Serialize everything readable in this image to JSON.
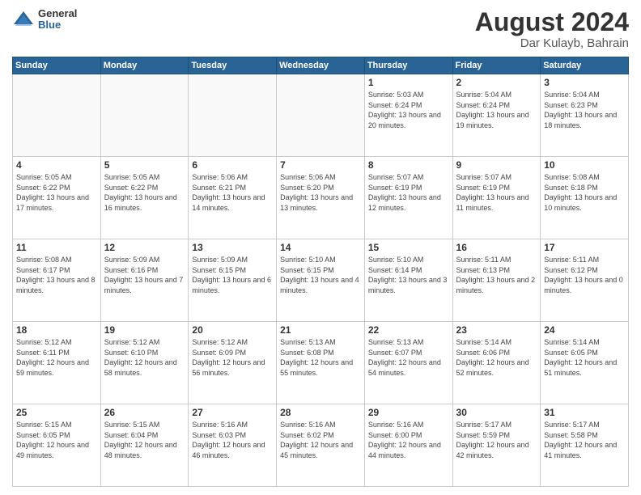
{
  "header": {
    "logo_general": "General",
    "logo_blue": "Blue",
    "month_year": "August 2024",
    "location": "Dar Kulayb, Bahrain"
  },
  "days_of_week": [
    "Sunday",
    "Monday",
    "Tuesday",
    "Wednesday",
    "Thursday",
    "Friday",
    "Saturday"
  ],
  "weeks": [
    [
      {
        "day": "",
        "empty": true
      },
      {
        "day": "",
        "empty": true
      },
      {
        "day": "",
        "empty": true
      },
      {
        "day": "",
        "empty": true
      },
      {
        "day": "1",
        "sunrise": "5:03 AM",
        "sunset": "6:24 PM",
        "daylight": "13 hours and 20 minutes."
      },
      {
        "day": "2",
        "sunrise": "5:04 AM",
        "sunset": "6:24 PM",
        "daylight": "13 hours and 19 minutes."
      },
      {
        "day": "3",
        "sunrise": "5:04 AM",
        "sunset": "6:23 PM",
        "daylight": "13 hours and 18 minutes."
      }
    ],
    [
      {
        "day": "4",
        "sunrise": "5:05 AM",
        "sunset": "6:22 PM",
        "daylight": "13 hours and 17 minutes."
      },
      {
        "day": "5",
        "sunrise": "5:05 AM",
        "sunset": "6:22 PM",
        "daylight": "13 hours and 16 minutes."
      },
      {
        "day": "6",
        "sunrise": "5:06 AM",
        "sunset": "6:21 PM",
        "daylight": "13 hours and 14 minutes."
      },
      {
        "day": "7",
        "sunrise": "5:06 AM",
        "sunset": "6:20 PM",
        "daylight": "13 hours and 13 minutes."
      },
      {
        "day": "8",
        "sunrise": "5:07 AM",
        "sunset": "6:19 PM",
        "daylight": "13 hours and 12 minutes."
      },
      {
        "day": "9",
        "sunrise": "5:07 AM",
        "sunset": "6:19 PM",
        "daylight": "13 hours and 11 minutes."
      },
      {
        "day": "10",
        "sunrise": "5:08 AM",
        "sunset": "6:18 PM",
        "daylight": "13 hours and 10 minutes."
      }
    ],
    [
      {
        "day": "11",
        "sunrise": "5:08 AM",
        "sunset": "6:17 PM",
        "daylight": "13 hours and 8 minutes."
      },
      {
        "day": "12",
        "sunrise": "5:09 AM",
        "sunset": "6:16 PM",
        "daylight": "13 hours and 7 minutes."
      },
      {
        "day": "13",
        "sunrise": "5:09 AM",
        "sunset": "6:15 PM",
        "daylight": "13 hours and 6 minutes."
      },
      {
        "day": "14",
        "sunrise": "5:10 AM",
        "sunset": "6:15 PM",
        "daylight": "13 hours and 4 minutes."
      },
      {
        "day": "15",
        "sunrise": "5:10 AM",
        "sunset": "6:14 PM",
        "daylight": "13 hours and 3 minutes."
      },
      {
        "day": "16",
        "sunrise": "5:11 AM",
        "sunset": "6:13 PM",
        "daylight": "13 hours and 2 minutes."
      },
      {
        "day": "17",
        "sunrise": "5:11 AM",
        "sunset": "6:12 PM",
        "daylight": "13 hours and 0 minutes."
      }
    ],
    [
      {
        "day": "18",
        "sunrise": "5:12 AM",
        "sunset": "6:11 PM",
        "daylight": "12 hours and 59 minutes."
      },
      {
        "day": "19",
        "sunrise": "5:12 AM",
        "sunset": "6:10 PM",
        "daylight": "12 hours and 58 minutes."
      },
      {
        "day": "20",
        "sunrise": "5:12 AM",
        "sunset": "6:09 PM",
        "daylight": "12 hours and 56 minutes."
      },
      {
        "day": "21",
        "sunrise": "5:13 AM",
        "sunset": "6:08 PM",
        "daylight": "12 hours and 55 minutes."
      },
      {
        "day": "22",
        "sunrise": "5:13 AM",
        "sunset": "6:07 PM",
        "daylight": "12 hours and 54 minutes."
      },
      {
        "day": "23",
        "sunrise": "5:14 AM",
        "sunset": "6:06 PM",
        "daylight": "12 hours and 52 minutes."
      },
      {
        "day": "24",
        "sunrise": "5:14 AM",
        "sunset": "6:05 PM",
        "daylight": "12 hours and 51 minutes."
      }
    ],
    [
      {
        "day": "25",
        "sunrise": "5:15 AM",
        "sunset": "6:05 PM",
        "daylight": "12 hours and 49 minutes."
      },
      {
        "day": "26",
        "sunrise": "5:15 AM",
        "sunset": "6:04 PM",
        "daylight": "12 hours and 48 minutes."
      },
      {
        "day": "27",
        "sunrise": "5:16 AM",
        "sunset": "6:03 PM",
        "daylight": "12 hours and 46 minutes."
      },
      {
        "day": "28",
        "sunrise": "5:16 AM",
        "sunset": "6:02 PM",
        "daylight": "12 hours and 45 minutes."
      },
      {
        "day": "29",
        "sunrise": "5:16 AM",
        "sunset": "6:00 PM",
        "daylight": "12 hours and 44 minutes."
      },
      {
        "day": "30",
        "sunrise": "5:17 AM",
        "sunset": "5:59 PM",
        "daylight": "12 hours and 42 minutes."
      },
      {
        "day": "31",
        "sunrise": "5:17 AM",
        "sunset": "5:58 PM",
        "daylight": "12 hours and 41 minutes."
      }
    ]
  ],
  "labels": {
    "sunrise_label": "Sunrise:",
    "sunset_label": "Sunset:",
    "daylight_label": "Daylight:"
  }
}
